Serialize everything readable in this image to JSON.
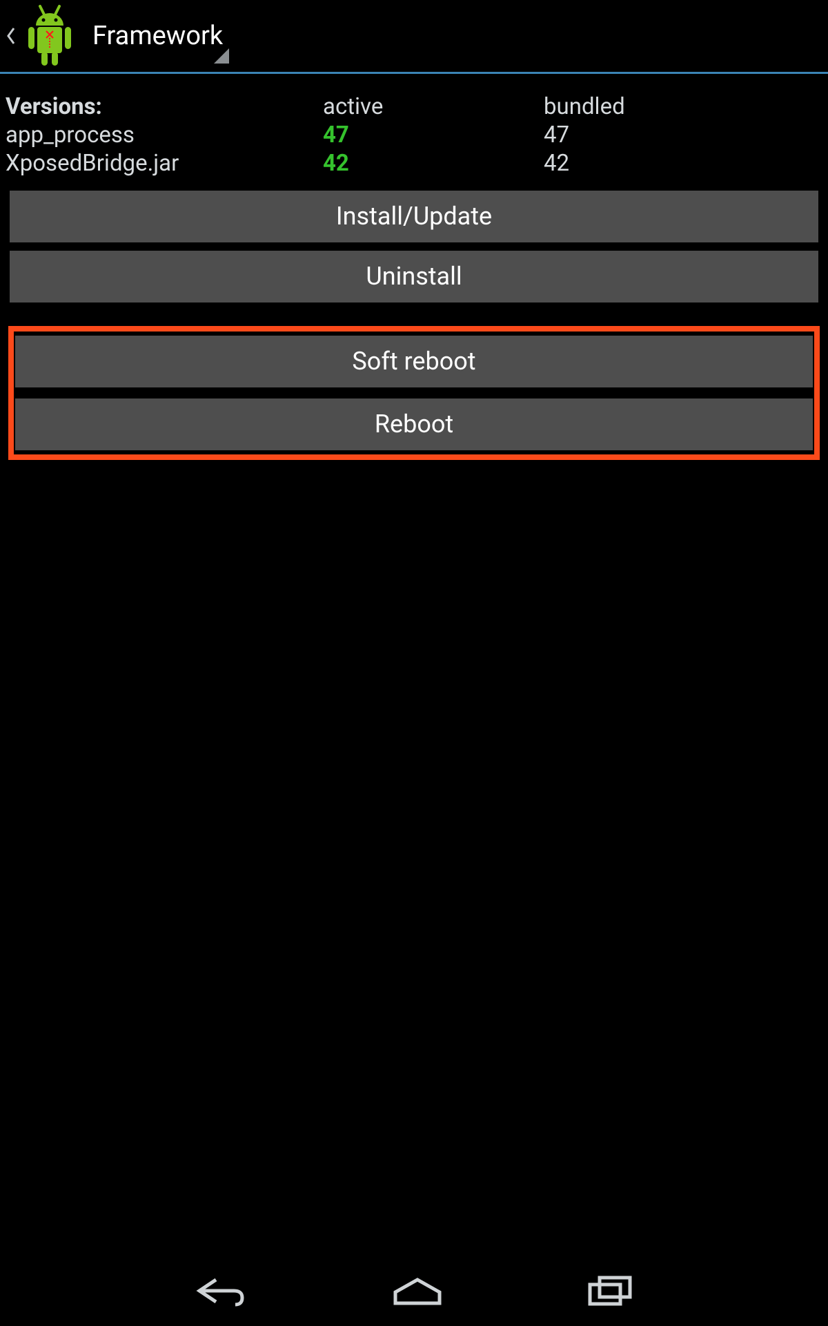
{
  "header": {
    "title": "Framework"
  },
  "versions": {
    "labels": {
      "title": "Versions:",
      "active": "active",
      "bundled": "bundled"
    },
    "rows": [
      {
        "name": "app_process",
        "active": "47",
        "bundled": "47"
      },
      {
        "name": "XposedBridge.jar",
        "active": "42",
        "bundled": "42"
      }
    ]
  },
  "buttons": {
    "install": "Install/Update",
    "uninstall": "Uninstall",
    "soft_reboot": "Soft reboot",
    "reboot": "Reboot"
  }
}
